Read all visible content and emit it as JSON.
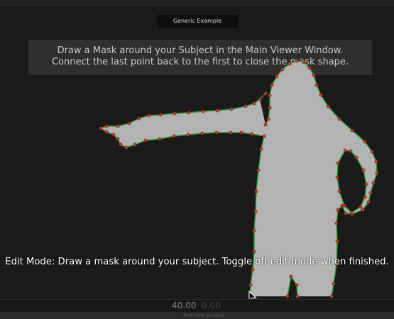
{
  "header": {
    "title": "Generic Example"
  },
  "instructions": {
    "line1": "Draw a Mask around your Subject in the Main Viewer Window.",
    "line2": "Connect the last point back to the first to close the mask shape."
  },
  "status": {
    "edit_mode_text": "Edit Mode: Draw a mask around your subject. Toggle off edit mode when finished."
  },
  "timeline": {
    "current": "40.00",
    "duration": "0.00"
  },
  "footer": {
    "credit": "Red Film Studios"
  },
  "colors": {
    "silhouette": "#b3b3b3",
    "mask_line": "#2f9a3a",
    "mask_point": "#c0392b"
  },
  "icons": {
    "cursor": "mouse-pointer-icon"
  }
}
